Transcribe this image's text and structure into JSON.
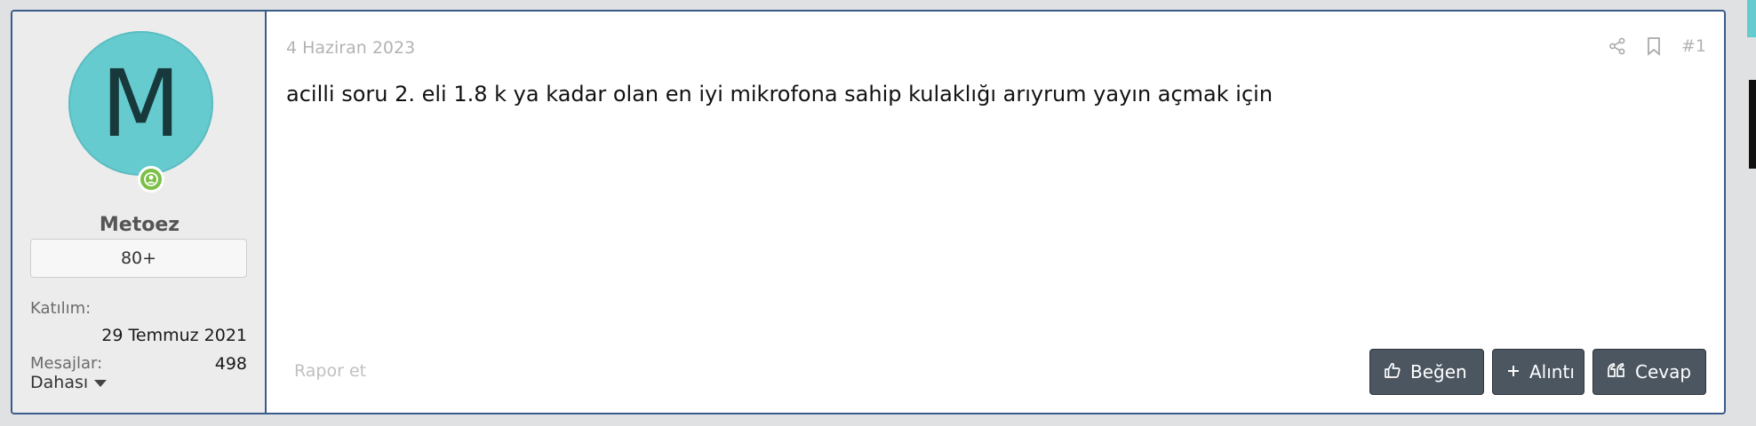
{
  "user": {
    "avatar_letter": "M",
    "username": "Metoez",
    "badge": "80+",
    "joined_label": "Katılım:",
    "joined_value": "29 Temmuz 2021",
    "messages_label": "Mesajlar:",
    "messages_value": "498",
    "more_label": "Dahası"
  },
  "post": {
    "date": "4 Haziran 2023",
    "number": "#1",
    "text": "acilli soru 2. eli 1.8 k ya kadar olan en iyi mikrofona sahip kulaklığı arıyrum yayın açmak için",
    "report_label": "Rapor et"
  },
  "actions": {
    "like_label": "Beğen",
    "quote_label": "Alıntı",
    "reply_label": "Cevap"
  },
  "colors": {
    "avatar": "#66cbcf",
    "border": "#3a5a8a",
    "button": "#4c5661",
    "online": "#7cc047"
  },
  "icons": [
    "online-status-icon",
    "caret-down-icon",
    "share-icon",
    "bookmark-icon",
    "thumbs-up-icon",
    "plus-icon",
    "quote-icon"
  ]
}
